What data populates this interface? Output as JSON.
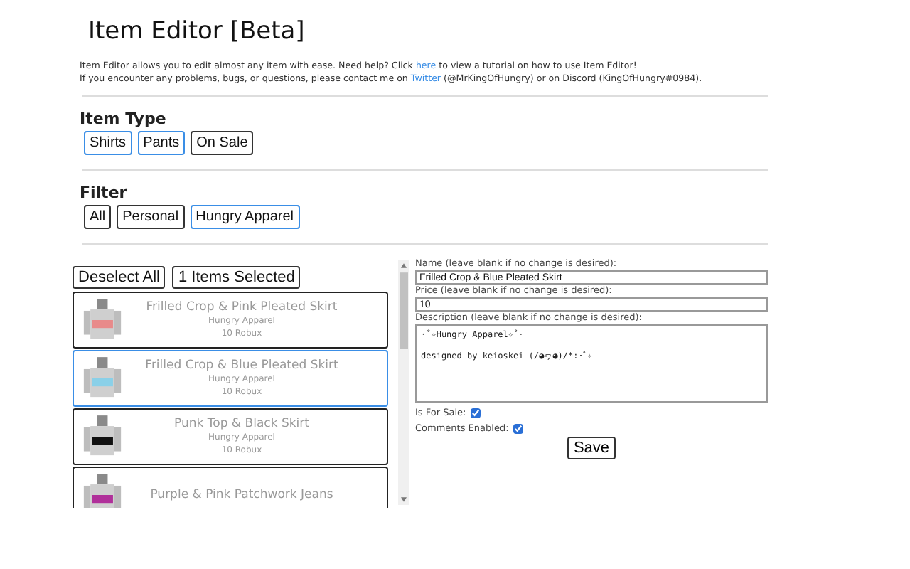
{
  "title": "Item Editor [Beta]",
  "intro": {
    "line1_before": "Item Editor allows you to edit almost any item with ease. Need help? Click ",
    "line1_link": "here",
    "line1_after": " to view a tutorial on how to use Item Editor!",
    "line2_before": "If you encounter any problems, bugs, or questions, please contact me on ",
    "line2_link": "Twitter",
    "line2_after": " (@MrKingOfHungry) or on Discord (KingOfHungry#0984)."
  },
  "item_type": {
    "heading": "Item Type",
    "options": [
      {
        "label": "Shirts",
        "selected": true
      },
      {
        "label": "Pants",
        "selected": true
      },
      {
        "label": "On Sale",
        "selected": false
      }
    ]
  },
  "filter": {
    "heading": "Filter",
    "options": [
      {
        "label": "All",
        "selected": false
      },
      {
        "label": "Personal",
        "selected": false
      },
      {
        "label": "Hungry Apparel",
        "selected": true
      }
    ]
  },
  "deselect_button": "Deselect All",
  "selection_count": "1 Items Selected",
  "items": [
    {
      "name": "Frilled Crop & Pink Pleated Skirt",
      "group": "Hungry Apparel",
      "price": "10 Robux",
      "color": "#e88a8a",
      "selected": false
    },
    {
      "name": "Frilled Crop & Blue Pleated Skirt",
      "group": "Hungry Apparel",
      "price": "10 Robux",
      "color": "#8ad0e8",
      "selected": true
    },
    {
      "name": "Punk Top & Black Skirt",
      "group": "Hungry Apparel",
      "price": "10 Robux",
      "color": "#111111",
      "selected": false
    },
    {
      "name": "Purple & Pink Patchwork Jeans",
      "color": "#b0309a",
      "selected": false
    }
  ],
  "form": {
    "name_label": "Name (leave blank if no change is desired):",
    "name_value": "Frilled Crop & Blue Pleated Skirt",
    "price_label": "Price (leave blank if no change is desired):",
    "price_value": "10",
    "description_label": "Description (leave blank if no change is desired):",
    "description_value": "·˚✧Hungry Apparel✧˚·\n\ndesigned by keioskei (/◕ヮ◕)/*:･ﾟ✧",
    "for_sale_label": "Is For Sale:",
    "for_sale": true,
    "comments_label": "Comments Enabled:",
    "comments": true,
    "save_button": "Save"
  }
}
